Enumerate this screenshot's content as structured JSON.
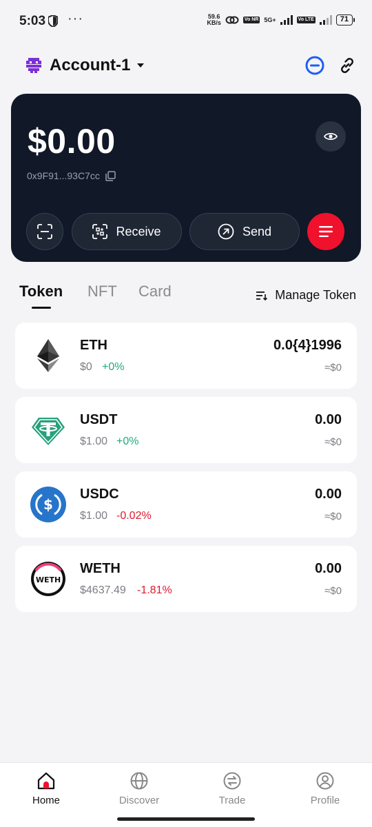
{
  "status_bar": {
    "time": "5:03",
    "dots": "···",
    "net_speed_value": "59.6",
    "net_speed_unit": "KB/s",
    "volte_tag_1": "Vo NR",
    "network_5g": "5G+",
    "volte_tag_2": "Vo LTE",
    "battery": "71"
  },
  "header": {
    "account_name": "Account-1"
  },
  "wallet_card": {
    "balance": "$0.00",
    "address": "0x9F91...93C7cc",
    "receive_label": "Receive",
    "send_label": "Send",
    "accent_color": "#f0112d"
  },
  "tabs": [
    {
      "label": "Token",
      "active": true
    },
    {
      "label": "NFT",
      "active": false
    },
    {
      "label": "Card",
      "active": false
    }
  ],
  "manage_token_label": "Manage Token",
  "tokens": [
    {
      "symbol": "ETH",
      "price": "$0",
      "change": "+0%",
      "amount": "0.0{4}1996",
      "value": "≈$0",
      "icon": "ethereum-icon"
    },
    {
      "symbol": "USDT",
      "price": "$1.00",
      "change": "+0%",
      "amount": "0.00",
      "value": "≈$0",
      "icon": "tether-icon"
    },
    {
      "symbol": "USDC",
      "price": "$1.00",
      "change": "-0.02%",
      "amount": "0.00",
      "value": "≈$0",
      "icon": "usdc-icon"
    },
    {
      "symbol": "WETH",
      "price": "$4637.49",
      "change": "-1.81%",
      "amount": "0.00",
      "value": "≈$0",
      "icon": "weth-icon"
    }
  ],
  "bottom_nav": [
    {
      "label": "Home",
      "active": true
    },
    {
      "label": "Discover",
      "active": false
    },
    {
      "label": "Trade",
      "active": false
    },
    {
      "label": "Profile",
      "active": false
    }
  ]
}
